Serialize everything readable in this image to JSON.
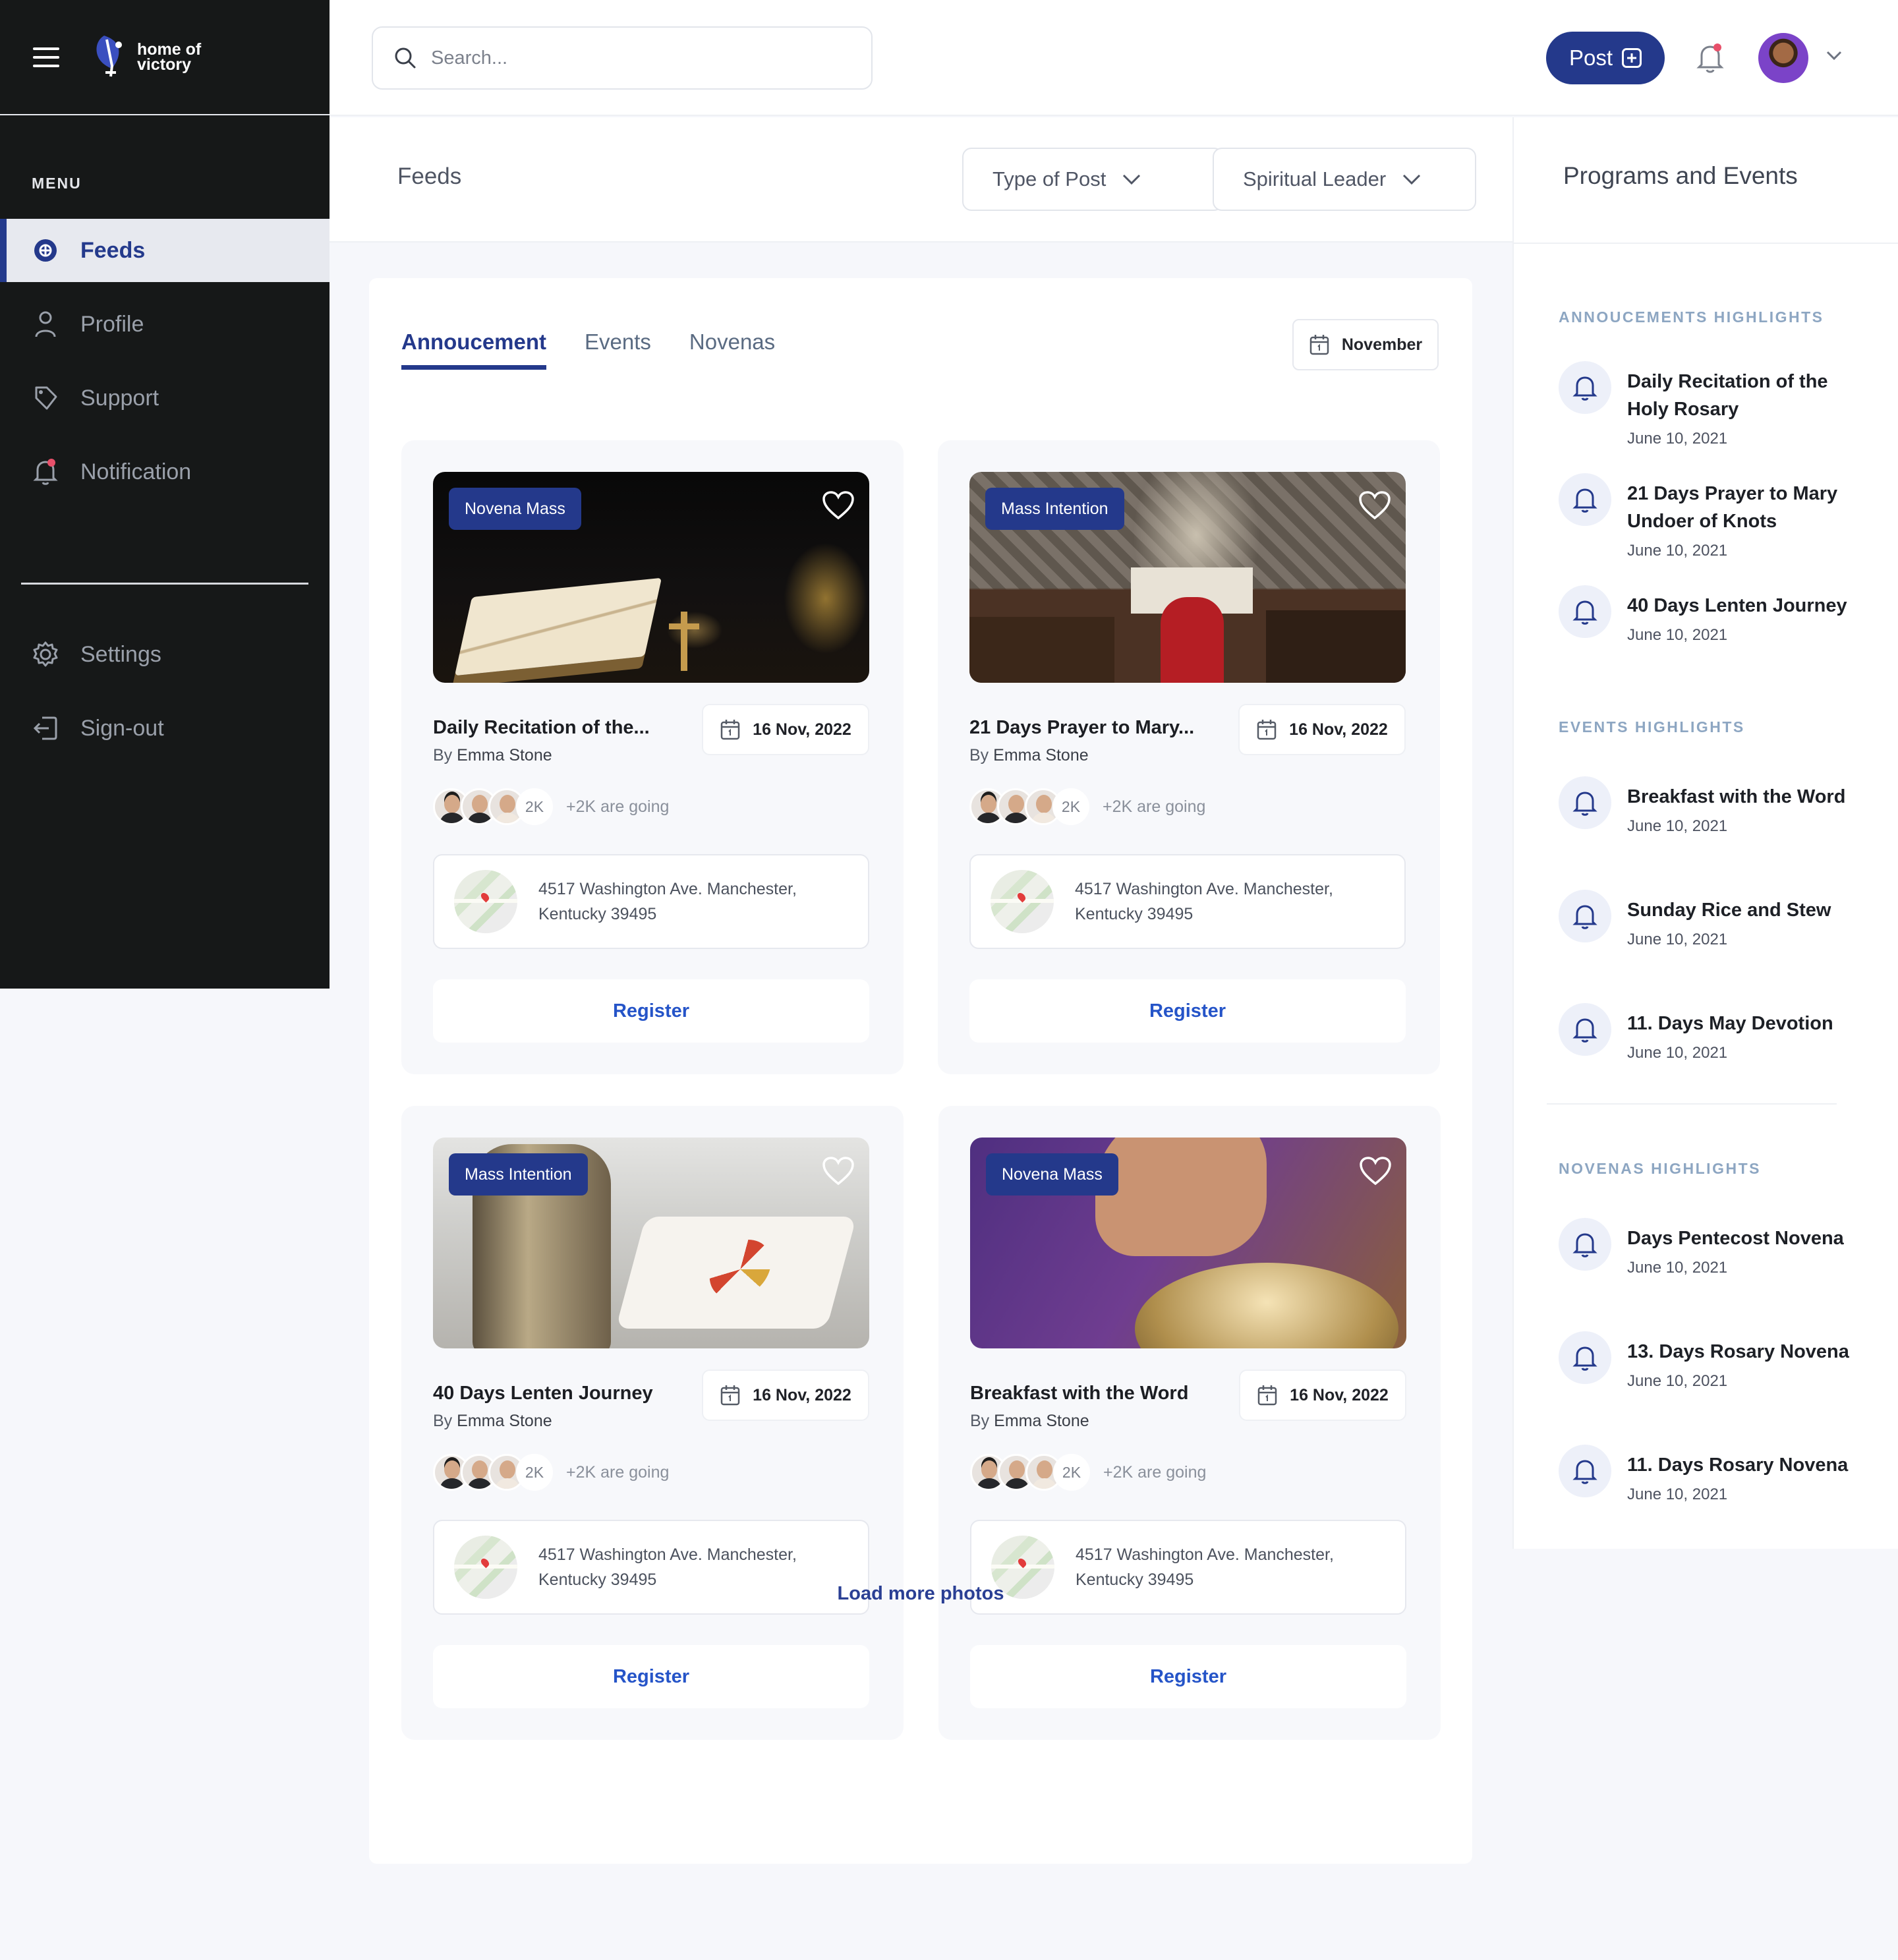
{
  "app": {
    "logo_line1": "home of",
    "logo_line2": "victory"
  },
  "sidebar": {
    "menu_heading": "MENU",
    "items": [
      {
        "label": "Feeds",
        "active": true
      },
      {
        "label": "Profile"
      },
      {
        "label": "Support"
      },
      {
        "label": "Notification"
      }
    ],
    "bottom_items": [
      {
        "label": "Settings"
      },
      {
        "label": "Sign-out"
      }
    ]
  },
  "topbar": {
    "search_placeholder": "Search...",
    "post_label": "Post"
  },
  "feeds": {
    "title": "Feeds",
    "filter_type": "Type of Post",
    "filter_leader": "Spiritual Leader",
    "tabs": [
      {
        "label": "Annoucement",
        "active": true
      },
      {
        "label": "Events"
      },
      {
        "label": "Novenas"
      }
    ],
    "month": "November",
    "cards": [
      {
        "tag": "Novena Mass",
        "title": "Daily Recitation of the...",
        "by_prefix": "By",
        "author": "Emma Stone",
        "date": "16 Nov, 2022",
        "count": "2K",
        "going": "+2K are going",
        "address": "4517 Washington Ave. Manchester, Kentucky 39495",
        "register": "Register"
      },
      {
        "tag": "Mass Intention",
        "title": "21 Days Prayer to Mary...",
        "by_prefix": "By",
        "author": "Emma Stone",
        "date": "16 Nov, 2022",
        "count": "2K",
        "going": "+2K are going",
        "address": "4517 Washington Ave. Manchester, Kentucky 39495",
        "register": "Register"
      },
      {
        "tag": "Mass Intention",
        "title": "40 Days Lenten Journey",
        "by_prefix": "By",
        "author": "Emma Stone",
        "date": "16 Nov, 2022",
        "count": "2K",
        "going": "+2K are going",
        "address": "4517 Washington Ave. Manchester, Kentucky 39495",
        "register": "Register"
      },
      {
        "tag": "Novena Mass",
        "title": "Breakfast with the Word",
        "by_prefix": "By",
        "author": "Emma Stone",
        "date": "16 Nov, 2022",
        "count": "2K",
        "going": "+2K are going",
        "address": "4517 Washington Ave. Manchester, Kentucky 39495",
        "register": "Register"
      }
    ],
    "load_more": "Load more photos"
  },
  "programs": {
    "title": "Programs and Events",
    "sections": [
      {
        "heading": "ANNOUCEMENTS  HIGHLIGHTS",
        "items": [
          {
            "name": "Daily Recitation of the Holy Rosary",
            "date": "June 10, 2021"
          },
          {
            "name": "21 Days Prayer to Mary Undoer of Knots",
            "date": "June 10, 2021"
          },
          {
            "name": "40 Days Lenten Journey",
            "date": "June 10, 2021"
          }
        ]
      },
      {
        "heading": "EVENTS  HIGHLIGHTS",
        "items": [
          {
            "name": "Breakfast with the Word",
            "date": "June 10, 2021"
          },
          {
            "name": "Sunday Rice and Stew",
            "date": "June 10, 2021"
          },
          {
            "name": "11. Days May Devotion",
            "date": "June 10, 2021"
          }
        ]
      },
      {
        "heading": "NOVENAS  HIGHLIGHTS",
        "items": [
          {
            "name": "Days Pentecost Novena",
            "date": "June 10, 2021"
          },
          {
            "name": "13. Days Rosary Novena",
            "date": "June 10, 2021"
          },
          {
            "name": "11. Days Rosary Novena",
            "date": "June 10, 2021"
          }
        ]
      }
    ]
  },
  "colors": {
    "primary": "#24398b",
    "sidebar_bg": "#161818",
    "register_text": "#2554c8",
    "notification_dot": "#e8506a"
  },
  "icons": {
    "menu": "hamburger-icon",
    "search": "search-icon",
    "bell": "bell-icon",
    "calendar": "calendar-icon",
    "heart": "heart-icon",
    "chevron": "chevron-down-icon"
  }
}
